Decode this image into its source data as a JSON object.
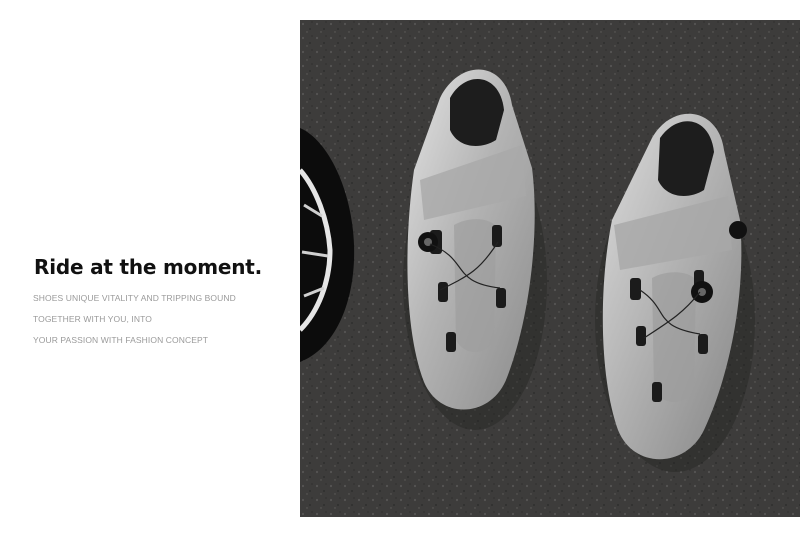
{
  "headline": "Ride at the moment.",
  "body_lines": [
    "SHOES UNIQUE VITALITY AND TRIPPING BOUND",
    "TOGETHER WITH YOU, INTO",
    "YOUR PASSION WITH FASHION CONCEPT"
  ],
  "colors": {
    "background": "#ffffff",
    "asphalt": "#3d3c3b",
    "shoe_silver": "#b9b9b9",
    "headline_text": "#111111",
    "body_text": "#9a9a9a"
  }
}
